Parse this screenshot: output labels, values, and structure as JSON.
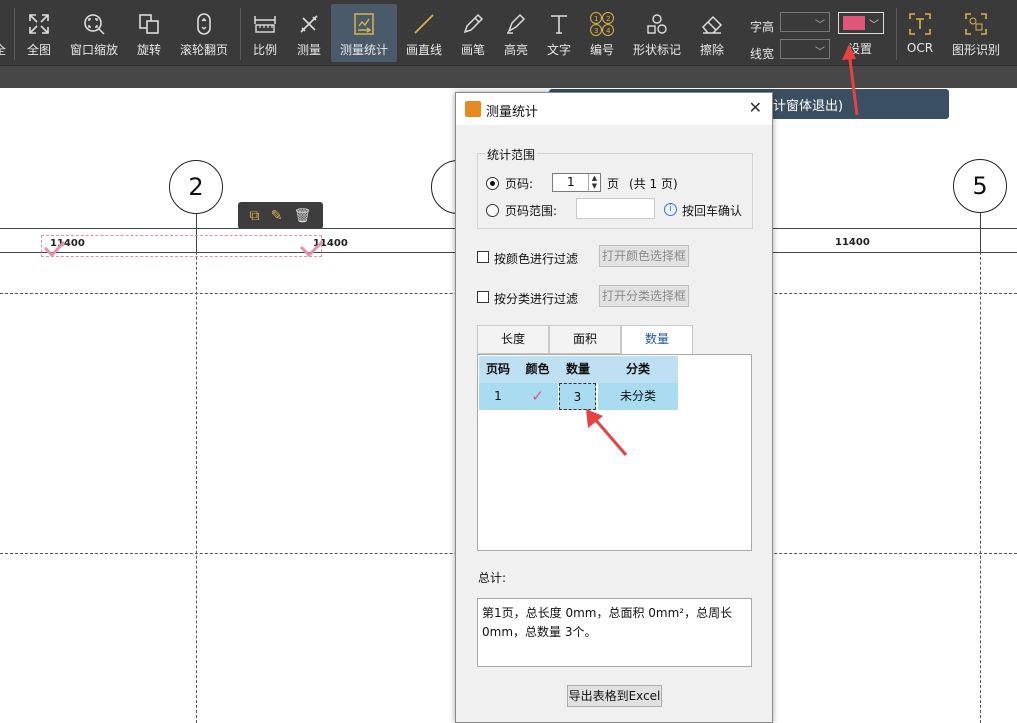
{
  "toolbar": {
    "items": [
      {
        "label": "全图",
        "icon": "fit-all-icon"
      },
      {
        "label": "窗口缩放",
        "icon": "window-zoom-icon"
      },
      {
        "label": "旋转",
        "icon": "rotate-icon"
      },
      {
        "label": "滚轮翻页",
        "icon": "mouse-wheel-icon"
      },
      {
        "label": "比例",
        "icon": "scale-ruler-icon"
      },
      {
        "label": "测量",
        "icon": "measure-icon"
      },
      {
        "label": "测量统计",
        "icon": "measure-statistics-icon"
      },
      {
        "label": "画直线",
        "icon": "line-icon"
      },
      {
        "label": "画笔",
        "icon": "pencil-icon"
      },
      {
        "label": "高亮",
        "icon": "highlighter-icon"
      },
      {
        "label": "文字",
        "icon": "text-icon"
      },
      {
        "label": "编号",
        "icon": "numbering-icon"
      },
      {
        "label": "形状标记",
        "icon": "shape-mark-icon"
      },
      {
        "label": "擦除",
        "icon": "eraser-icon"
      },
      {
        "label": "设置",
        "icon": "settings-icon"
      },
      {
        "label": "OCR",
        "icon": "ocr-icon"
      },
      {
        "label": "图形识别",
        "icon": "shape-recognition-icon"
      }
    ],
    "font_height_label": "字高",
    "line_width_label": "线宽",
    "color_swatch": "#e0567a",
    "left_cut_label": "全"
  },
  "canvas": {
    "axis_labels": [
      "2",
      "5"
    ],
    "dimensions": [
      "11400",
      "11400",
      "11400"
    ],
    "tip_text": "计窗体退出)"
  },
  "dialog": {
    "title": "测量统计",
    "range_group": "统计范围",
    "page_label": "页码:",
    "page_value": "1",
    "page_unit": "页",
    "page_total": "(共 1 页)",
    "range_label": "页码范围:",
    "range_hint": "按回车确认",
    "filter_color_label": "按颜色进行过滤",
    "filter_color_button": "打开颜色选择框",
    "filter_class_label": "按分类进行过滤",
    "filter_class_button": "打开分类选择框",
    "tabs": [
      "长度",
      "面积",
      "数量"
    ],
    "table": {
      "headers": [
        "页码",
        "颜色",
        "数量",
        "分类"
      ],
      "rows": [
        {
          "page": "1",
          "color": "✓",
          "count": "3",
          "category": "未分类"
        }
      ]
    },
    "total_label": "总计:",
    "total_text": "第1页，总长度 0mm，总面积 0mm²，总周长 0mm，总数量 3个。",
    "export_button": "导出表格到Excel"
  }
}
